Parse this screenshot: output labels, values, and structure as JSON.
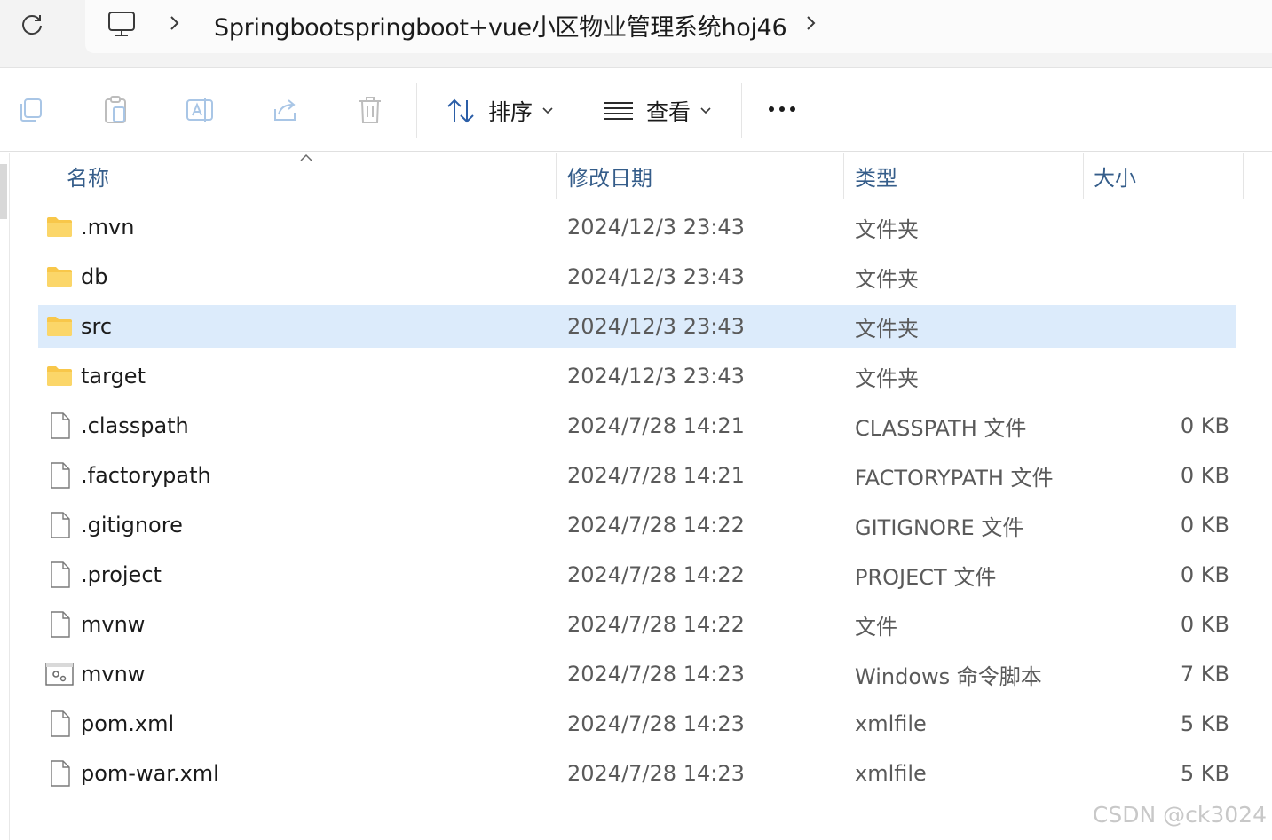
{
  "address_bar": {
    "path": "Springbootspringboot+vue小区物业管理系统hoj46"
  },
  "toolbar": {
    "sort_label": "排序",
    "view_label": "查看"
  },
  "columns": {
    "name": "名称",
    "date": "修改日期",
    "type": "类型",
    "size": "大小"
  },
  "files": [
    {
      "name": ".mvn",
      "date": "2024/12/3 23:43",
      "type": "文件夹",
      "size": "",
      "icon": "folder-icon"
    },
    {
      "name": "db",
      "date": "2024/12/3 23:43",
      "type": "文件夹",
      "size": "",
      "icon": "folder-icon"
    },
    {
      "name": "src",
      "date": "2024/12/3 23:43",
      "type": "文件夹",
      "size": "",
      "icon": "folder-icon",
      "selected": true
    },
    {
      "name": "target",
      "date": "2024/12/3 23:43",
      "type": "文件夹",
      "size": "",
      "icon": "folder-icon"
    },
    {
      "name": ".classpath",
      "date": "2024/7/28 14:21",
      "type": "CLASSPATH 文件",
      "size": "0 KB",
      "icon": "file-icon"
    },
    {
      "name": ".factorypath",
      "date": "2024/7/28 14:21",
      "type": "FACTORYPATH 文件",
      "size": "0 KB",
      "icon": "file-icon"
    },
    {
      "name": ".gitignore",
      "date": "2024/7/28 14:22",
      "type": "GITIGNORE 文件",
      "size": "0 KB",
      "icon": "file-icon"
    },
    {
      "name": ".project",
      "date": "2024/7/28 14:22",
      "type": "PROJECT 文件",
      "size": "0 KB",
      "icon": "file-icon"
    },
    {
      "name": "mvnw",
      "date": "2024/7/28 14:22",
      "type": "文件",
      "size": "0 KB",
      "icon": "file-icon"
    },
    {
      "name": "mvnw",
      "date": "2024/7/28 14:23",
      "type": "Windows 命令脚本",
      "size": "7 KB",
      "icon": "script-icon"
    },
    {
      "name": "pom.xml",
      "date": "2024/7/28 14:23",
      "type": "xmlfile",
      "size": "5 KB",
      "icon": "file-icon"
    },
    {
      "name": "pom-war.xml",
      "date": "2024/7/28 14:23",
      "type": "xmlfile",
      "size": "5 KB",
      "icon": "file-icon"
    }
  ],
  "watermark": "CSDN @ck3024",
  "colors": {
    "selection": "#dcebfb",
    "folder": "#f8c74a",
    "header_text": "#355d8a"
  }
}
